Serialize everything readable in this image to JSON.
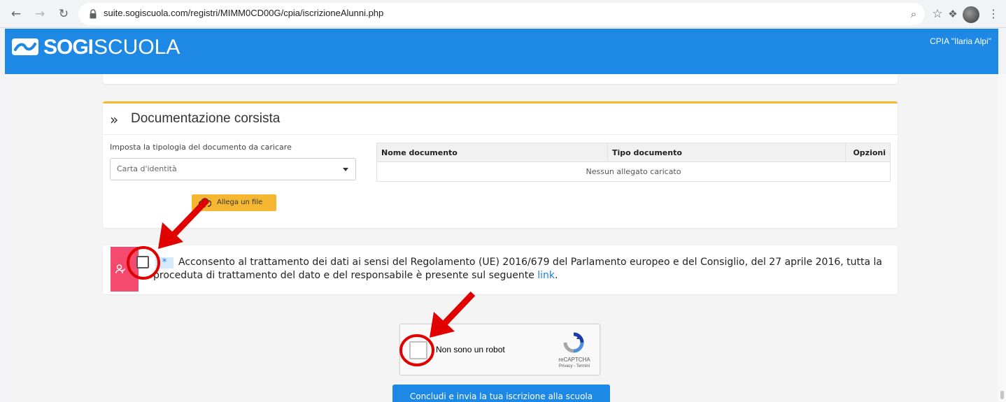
{
  "browser": {
    "url": "suite.sogiscuola.com/registri/MIMM0CD00G/cpia/iscrizioneAlunni.php"
  },
  "header": {
    "logo_bold": "SOGI",
    "logo_thin": "SCUOLA",
    "school_name": "CPIA \"Ilaria Alpi\""
  },
  "documentation": {
    "title": "Documentazione corsista",
    "select_label": "Imposta la tipologia del documento da caricare",
    "select_value": "Carta d'identità",
    "upload_label": "Allega un file",
    "table": {
      "headers": [
        "Nome documento",
        "Tipo documento",
        "Opzioni"
      ],
      "empty_message": "Nessun allegato caricato"
    }
  },
  "consent": {
    "required_mark": "*",
    "text": "Acconsento al trattamento dei dati ai sensi del Regolamento (UE) 2016/679 del Parlamento europeo e del Consiglio, del 27 aprile 2016, tutta la proceduta di trattamento del dato e del responsabile è presente sul seguente ",
    "link_text": "link",
    "text_end": "."
  },
  "recaptcha": {
    "label": "Non sono un robot",
    "brand": "reCAPTCHA",
    "terms": "Privacy - Termini"
  },
  "submit_label": "Concludi e invia la tua iscrizione alla scuola",
  "colors": {
    "brand_blue": "#1e88e5",
    "accent_yellow": "#f5b731",
    "badge_pink": "#f34a6e",
    "annotation_red": "#e00000"
  }
}
